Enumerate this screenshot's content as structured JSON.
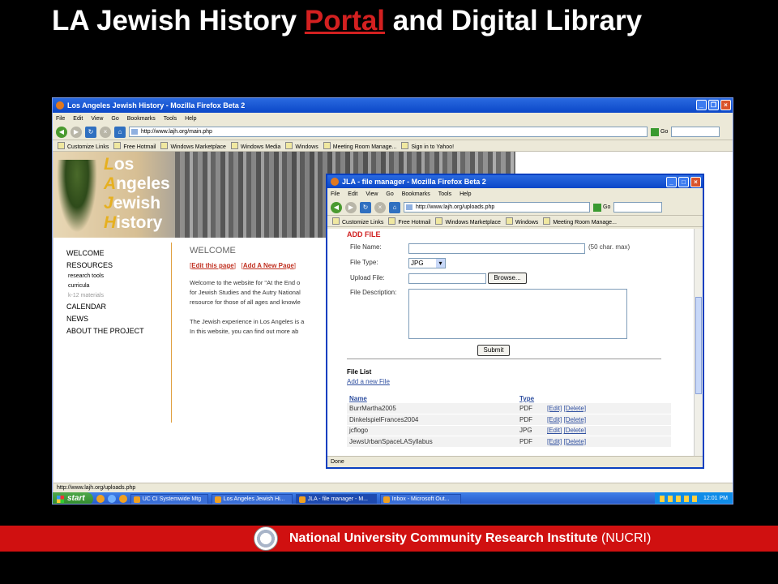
{
  "slide": {
    "title_pre": "LA Jewish History ",
    "title_link": "Portal",
    "title_post": " and Digital Library"
  },
  "browser": {
    "window_title": "Los Angeles Jewish History - Mozilla Firefox Beta 2",
    "menu": [
      "File",
      "Edit",
      "View",
      "Go",
      "Bookmarks",
      "Tools",
      "Help"
    ],
    "url": "http://www.lajh.org/main.php",
    "go_label": "Go",
    "bookmarks": [
      "Customize Links",
      "Free Hotmail",
      "Windows Marketplace",
      "Windows Media",
      "Windows",
      "Meeting Room Manage...",
      "Sign in to Yahoo!"
    ],
    "status": "http://www.lajh.org/uploads.php"
  },
  "site": {
    "logo_lines": [
      {
        "initial": "L",
        "rest": "os"
      },
      {
        "initial": "A",
        "rest": "ngeles"
      },
      {
        "initial": "J",
        "rest": "ewish"
      },
      {
        "initial": "H",
        "rest": "istory"
      }
    ],
    "nav": {
      "welcome": "WELCOME",
      "resources": "RESOURCES",
      "sub1": "research tools",
      "sub2": "curricula",
      "sub3": "k-12 materials",
      "calendar": "CALENDAR",
      "news": "NEWS",
      "about": "ABOUT THE PROJECT"
    },
    "heading": "WELCOME",
    "edit_link": "Edit this page",
    "add_link": "Add A New Page",
    "para1_l1": "Welcome to the website for \"At the End o",
    "para1_l2": "for Jewish Studies and the Autry National",
    "para1_l3": "resource for those of all ages and knowle",
    "para2_l1": "The Jewish experience in Los Angeles is a",
    "para2_l2": "In this website, you can find out more ab"
  },
  "popup": {
    "window_title": "JLA - file manager - Mozilla Firefox Beta 2",
    "url": "http://www.lajh.org/uploads.php",
    "add_file": "ADD FILE",
    "file_name_label": "File Name:",
    "file_name_hint": "(50 char. max)",
    "file_type_label": "File Type:",
    "file_type_value": "JPG",
    "upload_label": "Upload File:",
    "browse_label": "Browse...",
    "desc_label": "File Description:",
    "submit_label": "Submit",
    "file_list_title": "File List",
    "add_new_file": "Add a new File",
    "col_name": "Name",
    "col_type": "Type",
    "edit_label": "[Edit]",
    "delete_label": "[Delete]",
    "rows": [
      {
        "name": "BurrMartha2005",
        "type": "PDF"
      },
      {
        "name": "DinkelspielFrances2004",
        "type": "PDF"
      },
      {
        "name": "jcflogo",
        "type": "JPG"
      },
      {
        "name": "JewsUrbanSpaceLASyllabus",
        "type": "PDF"
      }
    ],
    "status": "Done"
  },
  "taskbar": {
    "start": "start",
    "tasks": [
      "UC CI Systemwide Mtg",
      "Los Angeles Jewish Hi...",
      "JLA - file manager - M...",
      "Inbox - Microsoft Out..."
    ],
    "clock": "12:01 PM"
  },
  "footer": {
    "org_bold": "National University Community Research Institute",
    "org_abbr": " (NUCRI)"
  }
}
